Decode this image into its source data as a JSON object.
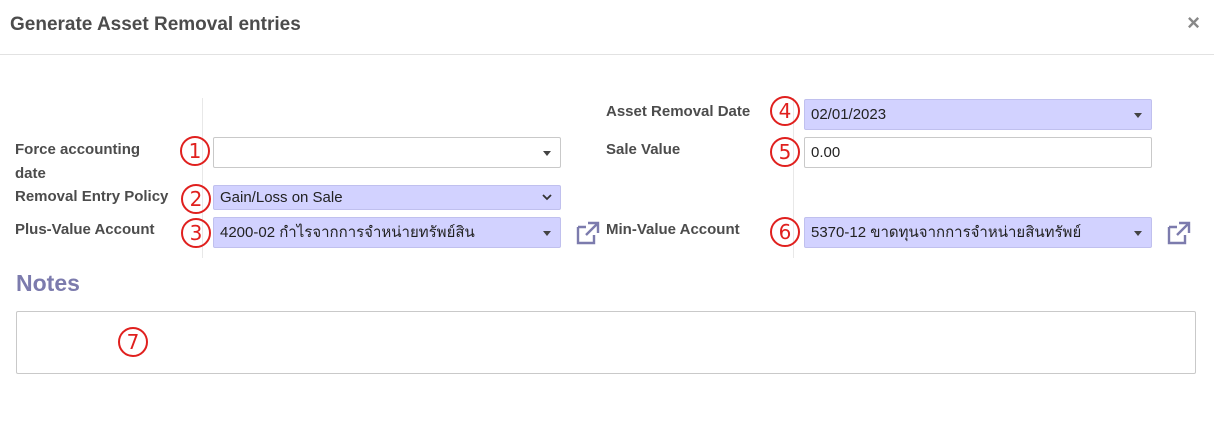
{
  "dialog": {
    "title": "Generate Asset Removal entries",
    "close_icon": "×"
  },
  "form": {
    "force_accounting_date": {
      "label": "Force accounting date",
      "value": ""
    },
    "removal_entry_policy": {
      "label": "Removal Entry Policy",
      "value": "Gain/Loss on Sale"
    },
    "plus_value_account": {
      "label": "Plus-Value Account",
      "value": "4200-02 กำไรจากการจำหน่ายทรัพย์สิน"
    },
    "asset_removal_date": {
      "label": "Asset Removal Date",
      "value": "02/01/2023"
    },
    "sale_value": {
      "label": "Sale Value",
      "value": "0.00"
    },
    "min_value_account": {
      "label": "Min-Value Account",
      "value": "5370-12 ขาดทุนจากการจำหน่ายสินทรัพย์"
    }
  },
  "notes": {
    "title": "Notes",
    "value": ""
  },
  "annotations": [
    "1",
    "2",
    "3",
    "4",
    "5",
    "6",
    "7"
  ],
  "colors": {
    "required_field_bg": "#d2d2ff",
    "notes_title": "#7c7bad",
    "annotation": "#e0201e"
  }
}
